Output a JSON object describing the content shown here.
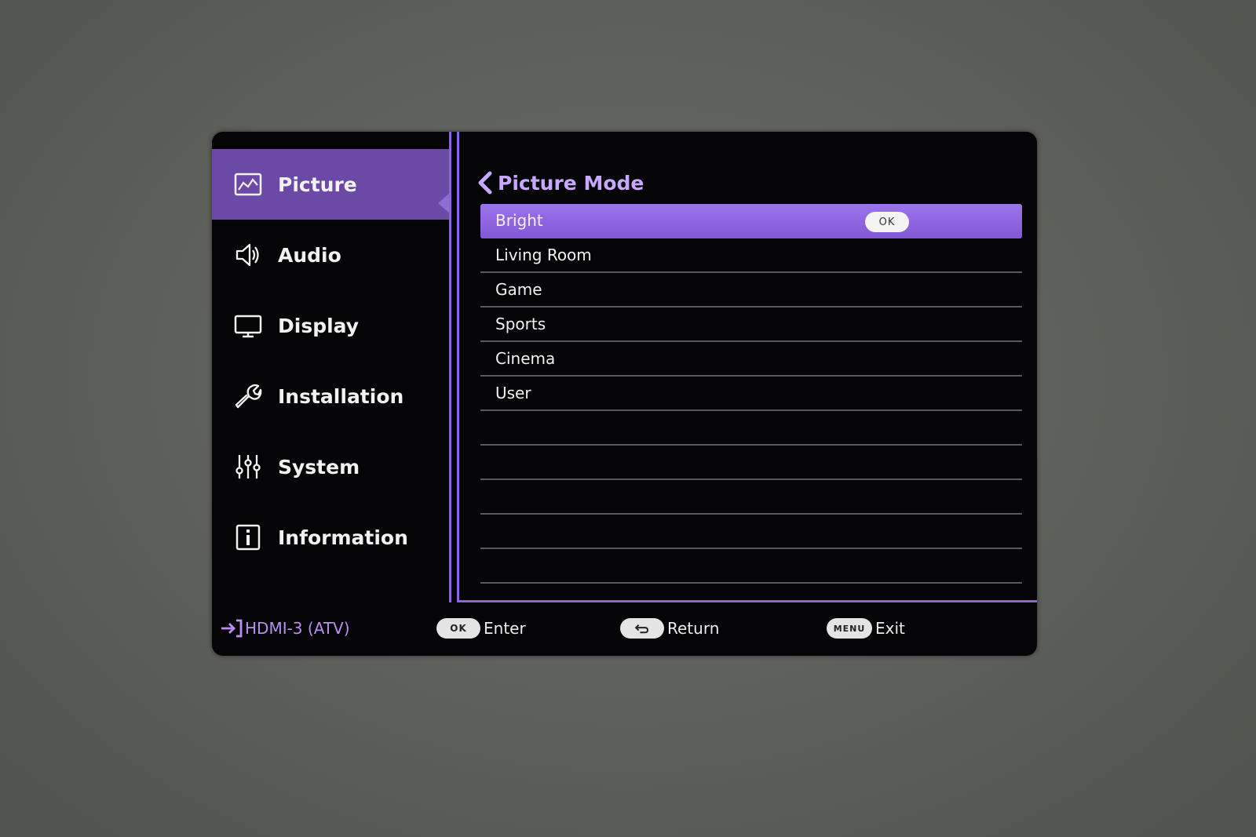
{
  "sidebar": {
    "items": [
      {
        "label": "Picture",
        "icon": "picture-icon",
        "active": true
      },
      {
        "label": "Audio",
        "icon": "speaker-icon",
        "active": false
      },
      {
        "label": "Display",
        "icon": "monitor-icon",
        "active": false
      },
      {
        "label": "Installation",
        "icon": "wrench-icon",
        "active": false
      },
      {
        "label": "System",
        "icon": "sliders-icon",
        "active": false
      },
      {
        "label": "Information",
        "icon": "info-icon",
        "active": false
      }
    ]
  },
  "content": {
    "title": "Picture Mode",
    "options": [
      "Bright",
      "Living Room",
      "Game",
      "Sports",
      "Cinema",
      "User"
    ],
    "selected": "Bright",
    "ok_label": "OK"
  },
  "footer": {
    "source": "HDMI-3 (ATV)",
    "hints": [
      {
        "key": "OK",
        "label": "Enter"
      },
      {
        "key": "↩",
        "label": "Return"
      },
      {
        "key": "MENU",
        "label": "Exit"
      }
    ]
  },
  "colors": {
    "accent": "#6a4aa6",
    "highlight": "#8f63e0",
    "title": "#c8a7ff",
    "source": "#b98ff4"
  }
}
